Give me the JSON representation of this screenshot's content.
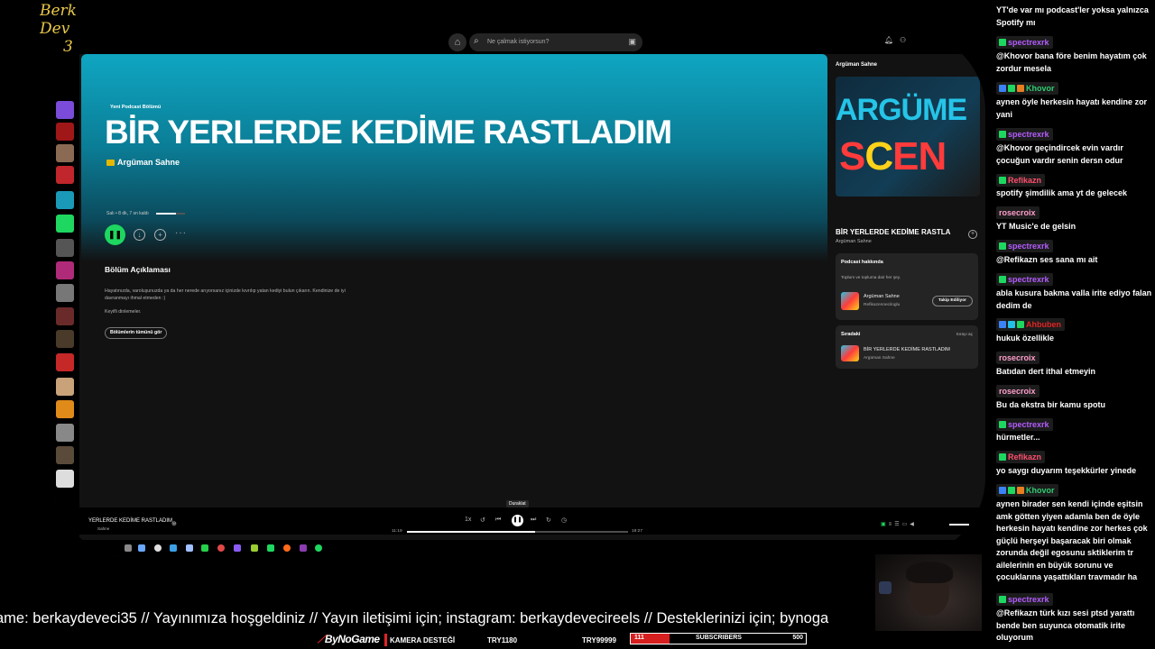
{
  "overlay": {
    "corner_text": [
      "Berk",
      "Dev",
      "3"
    ]
  },
  "spotify": {
    "search_placeholder": "Ne çalmak istiyorsun?",
    "episode": {
      "tag": "Yeni Podcast Bölümü",
      "title": "BİR YERLERDE KEDİME RASTLADIM",
      "show": "Argüman Sahne",
      "meta": "Salı • 8 dk, 7 sn kaldı",
      "progress": 0.7
    },
    "description": {
      "heading": "Bölüm Açıklaması",
      "body": "Hayatınızda, varoluşunuzda ya da her nerede arıyorsanız içinizde kıvrılıp yatan kediyi bulun çıkarın. Kendinize de iyi davranmayı ihmal etmeden :)",
      "closing": "Keyifli dinlemeler.",
      "all_episodes_button": "Bölümlerin tümünü gör"
    },
    "now_playing_panel": {
      "header": "Argüman Sahne",
      "cover_line1": "ARGÜME",
      "cover_line2": [
        "S",
        "C",
        "EN"
      ],
      "title": "BİR YERLERDE KEDİME RASTLA",
      "subtitle": "Argüman Sahne",
      "about": {
        "heading": "Podcast hakkında",
        "text": "Toplum ve topluma dair her şey.",
        "show_name": "Argüman Sahne",
        "host": "Refikazenneciloglu",
        "follow_button": "Takip Ediliyor"
      },
      "queue": {
        "heading": "Sıradaki",
        "open_link": "Sırayı aç",
        "item_title": "BİR YERLERDE KEDİME RASTLADIM",
        "item_show": "Argüman Sahne"
      }
    },
    "player": {
      "track": "YERLERDE KEDİME RASTLADIM",
      "show": "Sahne",
      "tooltip": "Duraklat",
      "speed": "1x",
      "elapsed": "11:19",
      "total": "19:27",
      "progress": 0.58
    }
  },
  "chat": [
    {
      "user": "",
      "color": "#ffffff",
      "badges": [],
      "text": "YT'de var mı podcast'ler yoksa yalnızca Spotify mı"
    },
    {
      "user": "spectrexrk",
      "color": "#b45cff",
      "badges": [
        "#1ed760"
      ],
      "text": "@Khovor bana före benim hayatım çok zordur mesela"
    },
    {
      "user": "Khovor",
      "color": "#2ecc71",
      "badges": [
        "#3b82f6",
        "#1ed760",
        "#e67e22"
      ],
      "text": "aynen öyle herkesin hayatı kendine zor yani"
    },
    {
      "user": "spectrexrk",
      "color": "#b45cff",
      "badges": [
        "#1ed760"
      ],
      "text": "@Khovor geçindircek evin vardır çocuğun vardır senin dersn odur"
    },
    {
      "user": "Refikazn",
      "color": "#ff4f6d",
      "badges": [
        "#1ed760"
      ],
      "text": "spotify şimdilik ama yt de gelecek"
    },
    {
      "user": "rosecroix",
      "color": "#ff9ecb",
      "badges": [],
      "text": "YT Music'e de gelsin"
    },
    {
      "user": "spectrexrk",
      "color": "#b45cff",
      "badges": [
        "#1ed760"
      ],
      "text": "@Refikazn ses sana mı ait"
    },
    {
      "user": "spectrexrk",
      "color": "#b45cff",
      "badges": [
        "#1ed760"
      ],
      "text": "abla kusura bakma valla irite ediyo falan dedim de"
    },
    {
      "user": "Ahbuben",
      "color": "#e02424",
      "badges": [
        "#3b82f6",
        "#22c0e8",
        "#1ed760"
      ],
      "text": "hukuk özellikle"
    },
    {
      "user": "rosecroix",
      "color": "#ff9ecb",
      "badges": [],
      "text": "Batıdan dert ithal etmeyin"
    },
    {
      "user": "rosecroix",
      "color": "#ff9ecb",
      "badges": [],
      "text": "Bu da ekstra bir kamu spotu"
    },
    {
      "user": "spectrexrk",
      "color": "#b45cff",
      "badges": [
        "#1ed760"
      ],
      "text": "hürmetler..."
    },
    {
      "user": "Refikazn",
      "color": "#ff4f6d",
      "badges": [
        "#1ed760"
      ],
      "text": "yo saygı duyarım teşekkürler yinede"
    },
    {
      "user": "Khovor",
      "color": "#2ecc71",
      "badges": [
        "#3b82f6",
        "#1ed760",
        "#e67e22"
      ],
      "text": "aynen birader sen kendi içinde eşitsin amk götten yiyen adamla ben de öyle herkesin hayatı kendine zor herkes çok güçlü herşeyi başaracak biri olmak zorunda değil egosunu sktiklerim tr ailelerinin en büyük sorunu ve çocuklarına yaşattıkları travmadır ha"
    },
    {
      "user": "spectrexrk",
      "color": "#b45cff",
      "badges": [
        "#1ed760"
      ],
      "text": "@Refikazn türk kızı sesi ptsd yarattı bende ben suyunca otomatik irite oluyorum"
    }
  ],
  "ticker": "ame: berkaydeveci35 // Yayınımıza hoşgeldiniz // Yayın iletişimi için; instagram: berkaydevecireels // Desteklerinizi için; bynoga",
  "footer": {
    "brand": "ByNoGame",
    "camera_support": "KAMERA DESTEĞİ",
    "donation_1": "TRY1180",
    "donation_2": "TRY99999",
    "subs_current": "111",
    "subs_label": "SUBSCRIBERS",
    "subs_goal": "500",
    "subs_progress": 0.222
  }
}
